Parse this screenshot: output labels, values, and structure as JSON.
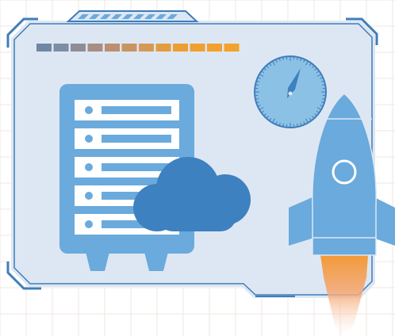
{
  "illustration": {
    "segment_bar": {
      "colors": [
        "#6f87a4",
        "#7d8ea4",
        "#908c96",
        "#a78d84",
        "#bb8f70",
        "#c99463",
        "#d69955",
        "#e39c40",
        "#ec9e33",
        "#f0a030",
        "#f2a12c",
        "#f3a22a"
      ]
    },
    "server": {
      "slot_count": 5
    },
    "colors": {
      "frame": "#3f7dba",
      "panel_bg": "#dde7f3",
      "server": "#6aaadc",
      "cloud": "#3d81c0",
      "rocket": "#6aaadc",
      "rocket_flame": "#f29a38",
      "gauge": "#8cc1e6",
      "grid": "#efe7e0"
    }
  }
}
